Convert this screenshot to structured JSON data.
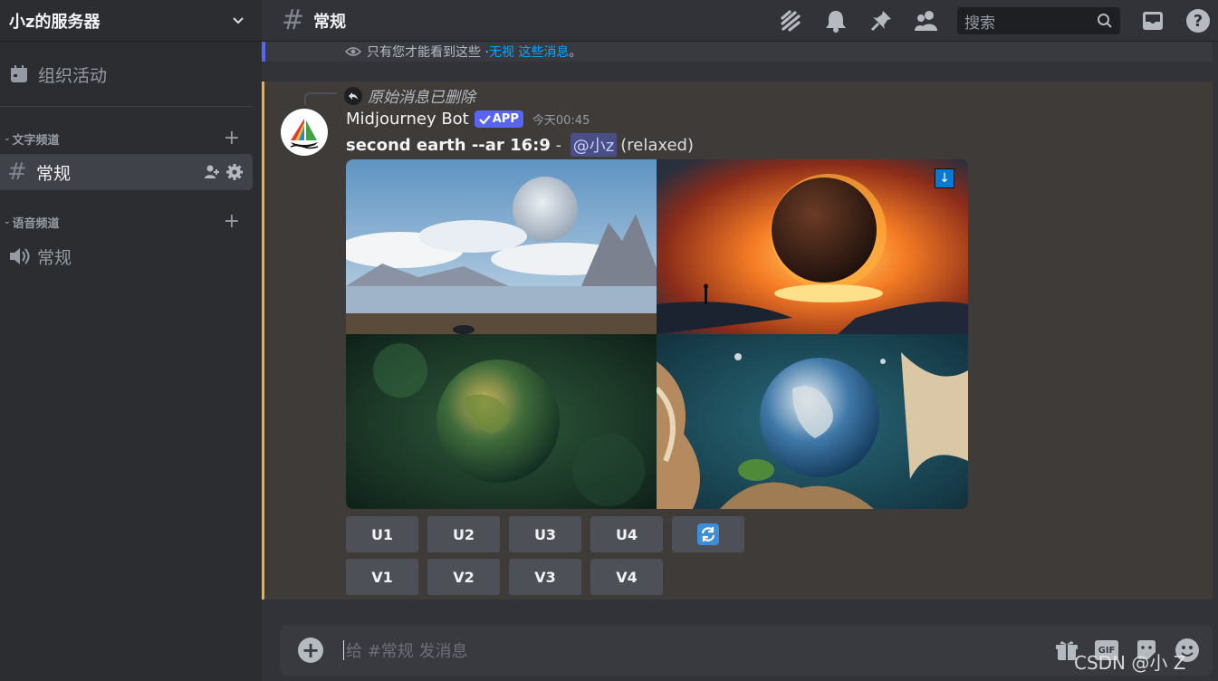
{
  "server": {
    "name": "小z的服务器"
  },
  "sidebar": {
    "events_label": "组织活动",
    "categories": [
      {
        "label": "文字频道",
        "channels": [
          {
            "name": "常规",
            "type": "text",
            "active": true
          }
        ]
      },
      {
        "label": "语音频道",
        "channels": [
          {
            "name": "常规",
            "type": "voice",
            "active": false
          }
        ]
      }
    ]
  },
  "header": {
    "channel": "常规",
    "icons": [
      "threads-icon",
      "bell-icon",
      "pin-icon",
      "members-icon",
      "inbox-icon",
      "help-icon"
    ],
    "search_placeholder": "搜索"
  },
  "ephemeral": {
    "text": "只有您才能看到这些 · ",
    "dismiss_link": "无视 这些消息",
    "suffix": "。"
  },
  "message": {
    "reply_text": "原始消息已删除",
    "author": "Midjourney Bot",
    "app_tag": "APP",
    "timestamp": "今天00:45",
    "prompt": "second earth --ar 16:9",
    "separator": " - ",
    "mention": "@小z",
    "mode": "(relaxed)",
    "images": [
      "moon-over-mountain-lake",
      "planet-in-fiery-sky",
      "green-nebula-earth",
      "earth-with-coral-and-ocean"
    ],
    "upscale_buttons": [
      "U1",
      "U2",
      "U3",
      "U4"
    ],
    "variation_buttons": [
      "V1",
      "V2",
      "V3",
      "V4"
    ],
    "reroll_icon": "refresh-icon"
  },
  "composer": {
    "placeholder": "给 #常规 发消息",
    "icons": [
      "gift-icon",
      "gif-icon",
      "sticker-icon",
      "emoji-icon"
    ],
    "gif_label": "GIF"
  },
  "watermark": "CSDN @小 Z",
  "colors": {
    "accent": "#5865f2",
    "highlight_border": "#f0b232",
    "link": "#00a8fc",
    "button": "#4e5058"
  }
}
